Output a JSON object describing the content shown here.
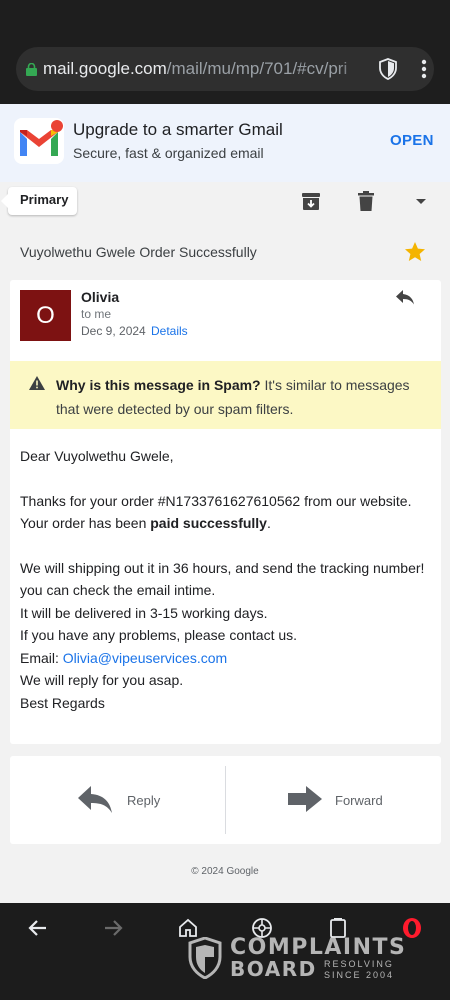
{
  "browser": {
    "url_host": "mail.google.com",
    "url_path": "/mail/mu/mp/701/#cv/pri"
  },
  "promo": {
    "title": "Upgrade to a smarter Gmail",
    "subtitle": "Secure, fast & organized email",
    "open_label": "OPEN"
  },
  "toolbar": {
    "label_chip": "Primary"
  },
  "email": {
    "subject": "Vuyolwethu Gwele Order Successfully",
    "avatar_letter": "O",
    "sender": "Olivia",
    "recipient": "to me",
    "date": "Dec 9, 2024",
    "details_link": "Details",
    "spam_title": "Why is this message in Spam?",
    "spam_text": " It's similar to messages that were detected by our spam filters.",
    "greeting": "Dear Vuyolwethu Gwele,",
    "order_line_1": "Thanks for your order #N1733761627610562 from our website.",
    "order_line_2_prefix": "Your order has been ",
    "order_line_2_bold": "paid successfully",
    "order_line_2_suffix": ".",
    "shipping_line": "We will shipping out it in 36 hours, and send the tracking number! you can check the email intime.",
    "delivery_line": "It will be delivered in 3-15 working days.",
    "problems_line": "If you have any problems, please contact us.",
    "email_label": "Email: ",
    "email_address": "Olivia@vipeuservices.com",
    "reply_line": "We will reply for you asap.",
    "signoff": "Best Regards"
  },
  "actions": {
    "reply_label": "Reply",
    "forward_label": "Forward"
  },
  "footer": {
    "copyright": "© 2024 Google"
  },
  "watermark": {
    "line1": "COMPLAINTS",
    "line2": "BOARD",
    "tag1": "RESOLVING",
    "tag2": "SINCE 2004"
  },
  "colors": {
    "accent": "#1a73e8",
    "avatar": "#7d1212",
    "spam_bg": "#fcf8c5",
    "star": "#f4b400",
    "browser_bg": "#1e1e1e"
  }
}
